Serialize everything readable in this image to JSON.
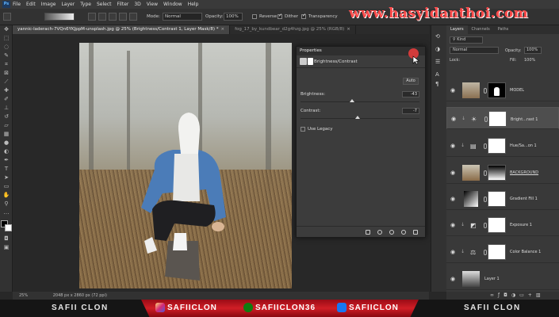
{
  "menu": [
    "File",
    "Edit",
    "Image",
    "Layer",
    "Type",
    "Select",
    "Filter",
    "3D",
    "View",
    "Window",
    "Help"
  ],
  "options": {
    "mode_label": "Mode:",
    "mode_value": "Normal",
    "opacity_label": "Opacity:",
    "opacity_value": "100%",
    "reverse_label": "Reverse",
    "dither_label": "Dither",
    "transparency_label": "Transparency"
  },
  "watermark": "www.hasyidanthoi.com",
  "tabs": [
    {
      "label": "yannic-laderach-7VQn6YKJppM-unsplash.jpg @ 25% (Brightness/Contrast 1, Layer Mask/8) *",
      "active": true
    },
    {
      "label": "fog_17_by_kundbear_d2g4hzg.jpg @ 25% (RGB/8)",
      "active": false
    }
  ],
  "status": {
    "zoom": "25%",
    "doc": "2048 px x 2860 px (72 ppi)"
  },
  "properties": {
    "title": "Properties",
    "subtitle": "Brightness/Contrast",
    "auto_label": "Auto",
    "brightness_label": "Brightness:",
    "brightness_value": "-43",
    "brightness_level": 0.43,
    "contrast_label": "Contrast:",
    "contrast_value": "-7",
    "contrast_level": 0.48,
    "legacy_label": "Use Legacy"
  },
  "layers_panel": {
    "tabs": [
      "Layers",
      "Channels",
      "Paths"
    ],
    "kind_label": "Kind",
    "blend_value": "Normal",
    "opacity_label": "Opacity:",
    "opacity_value": "100%",
    "lock_label": "Lock:",
    "fill_label": "Fill:",
    "fill_value": "100%",
    "layers": [
      {
        "name": "MODEL"
      },
      {
        "name": "Bright...rast 1"
      },
      {
        "name": "Hue/Sa...on 1"
      },
      {
        "name": "BACKGROUND"
      },
      {
        "name": "Gradient Fill 1"
      },
      {
        "name": "Exposure 1"
      },
      {
        "name": "Color Balance 1"
      },
      {
        "name": "Layer 1"
      }
    ]
  },
  "banner": {
    "left": "SAFII CLON",
    "instagram": "SAFIICLON",
    "xbox": "SAFIICLON36",
    "facebook": "SAFIICLON",
    "right": "SAFII CLON"
  },
  "colors": {
    "accent_red": "#d01e26",
    "watermark_red": "#ff4a4a"
  }
}
